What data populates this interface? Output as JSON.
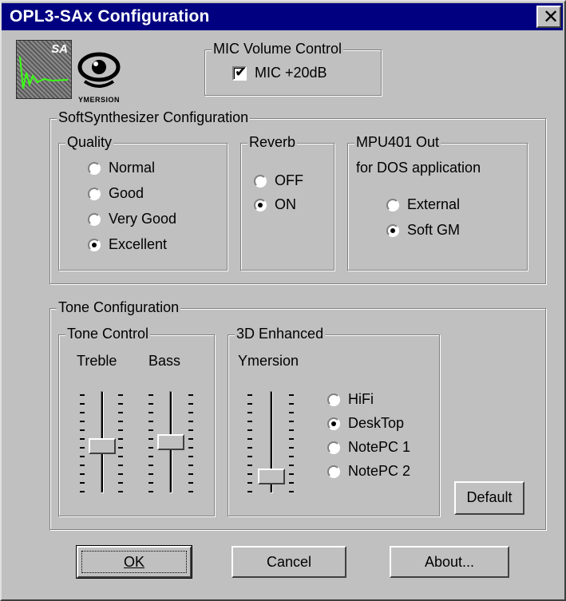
{
  "window": {
    "title": "OPL3-SAx Configuration",
    "close_glyph": "✕"
  },
  "logos": {
    "sa_text": "SA",
    "ymersion_text": "YMERSION"
  },
  "mic": {
    "group_label": "MIC Volume Control",
    "checkbox_label": "MIC +20dB",
    "checked": true
  },
  "soft_synth": {
    "group_label": "SoftSynthesizer Configuration",
    "quality": {
      "label": "Quality",
      "options": [
        "Normal",
        "Good",
        "Very Good",
        "Excellent"
      ],
      "selected": "Excellent"
    },
    "reverb": {
      "label": "Reverb",
      "options": [
        "OFF",
        "ON"
      ],
      "selected": "ON"
    },
    "mpu": {
      "label": "MPU401 Out",
      "sublabel": "for DOS application",
      "options": [
        "External",
        "Soft GM"
      ],
      "selected": "Soft GM"
    }
  },
  "tone": {
    "group_label": "Tone Configuration",
    "tone_control": {
      "label": "Tone Control",
      "treble_label": "Treble",
      "bass_label": "Bass",
      "treble_level": 0.45,
      "bass_level": 0.5
    },
    "enhanced": {
      "label": "3D Enhanced",
      "ymersion_label": "Ymersion",
      "ymersion_level": 0.1,
      "options": [
        "HiFi",
        "DeskTop",
        "NotePC 1",
        "NotePC 2"
      ],
      "selected": "DeskTop"
    },
    "default_button": "Default"
  },
  "buttons": {
    "ok": "OK",
    "cancel": "Cancel",
    "about": "About..."
  },
  "colors": {
    "titlebar": "#000080",
    "face": "#c0c0c0"
  }
}
